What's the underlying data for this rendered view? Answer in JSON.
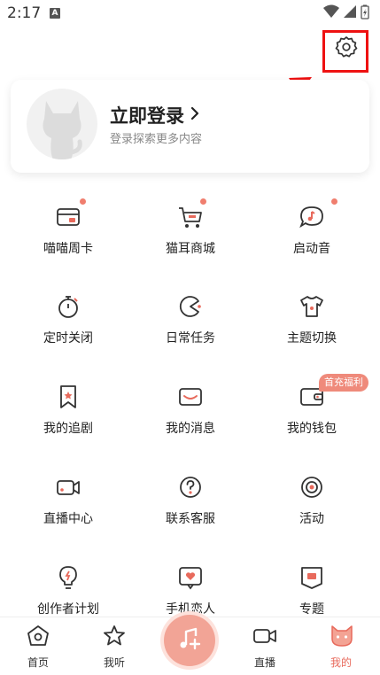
{
  "status_bar": {
    "time": "2:17",
    "notif_letter": "A"
  },
  "profile": {
    "title": "立即登录",
    "subtitle": "登录探索更多内容"
  },
  "menu": {
    "items": [
      {
        "label": "喵喵周卡",
        "icon": "card-icon",
        "dot": true
      },
      {
        "label": "猫耳商城",
        "icon": "cart-icon",
        "dot": true
      },
      {
        "label": "启动音",
        "icon": "music-bubble-icon",
        "dot": true
      },
      {
        "label": "定时关闭",
        "icon": "timer-icon",
        "dot": false
      },
      {
        "label": "日常任务",
        "icon": "pacman-icon",
        "dot": false
      },
      {
        "label": "主题切换",
        "icon": "tshirt-icon",
        "dot": false
      },
      {
        "label": "我的追剧",
        "icon": "bookmark-icon",
        "dot": false
      },
      {
        "label": "我的消息",
        "icon": "envelope-icon",
        "dot": false
      },
      {
        "label": "我的钱包",
        "icon": "wallet-icon",
        "dot": false
      },
      {
        "label": "直播中心",
        "icon": "video-camera-icon",
        "dot": false
      },
      {
        "label": "联系客服",
        "icon": "help-icon",
        "dot": false
      },
      {
        "label": "活动",
        "icon": "activity-icon",
        "dot": false
      },
      {
        "label": "创作者计划",
        "icon": "bulb-icon",
        "dot": false
      },
      {
        "label": "手机恋人",
        "icon": "heart-chat-icon",
        "dot": false
      },
      {
        "label": "专题",
        "icon": "topic-icon",
        "dot": false
      }
    ],
    "promo_badge": "首充福利"
  },
  "nav": {
    "items": [
      {
        "label": "首页",
        "icon": "home-icon",
        "active": false
      },
      {
        "label": "我听",
        "icon": "star-icon",
        "active": false
      },
      {
        "label": "直播",
        "icon": "live-camera-icon",
        "active": false
      },
      {
        "label": "我的",
        "icon": "cat-face-icon",
        "active": true
      }
    ],
    "center_icon": "music-add-icon"
  },
  "colors": {
    "accent": "#e86a5c",
    "highlight": "#ee1111"
  }
}
